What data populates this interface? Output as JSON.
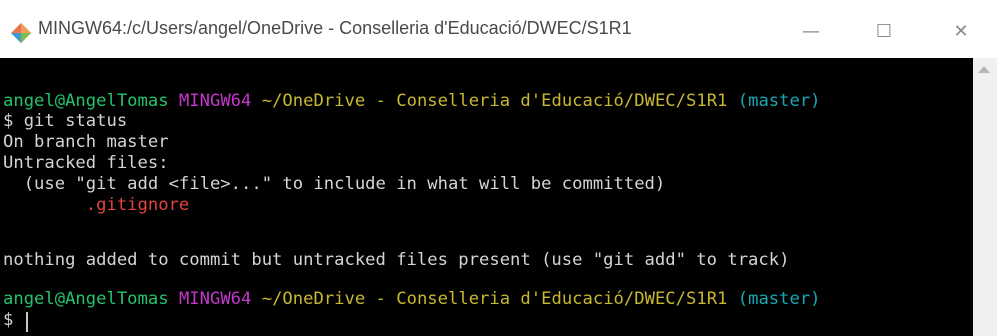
{
  "window": {
    "title": "MINGW64:/c/Users/angel/OneDrive - Conselleria d'Educació/DWEC/S1R1",
    "minimize_glyph": "—",
    "maximize_glyph": "☐",
    "close_glyph": "✕"
  },
  "icons": {
    "app": "git-bash-icon",
    "minimize": "minimize-icon",
    "maximize": "maximize-icon",
    "close": "close-icon"
  },
  "colors": {
    "prompt_user": "#23c36b",
    "prompt_env": "#c337ca",
    "prompt_path": "#c8b730",
    "prompt_branch": "#18a8b4",
    "untracked_file": "#e0443f"
  },
  "terminal": {
    "prompt1": {
      "user": "angel@AngelTomas",
      "env": "MINGW64",
      "path": "~/OneDrive - Conselleria d'Educació/DWEC/S1R1",
      "branch": "(master)"
    },
    "command1": "$ git status",
    "output": [
      "On branch master",
      "Untracked files:",
      "  (use \"git add <file>...\" to include in what will be committed)",
      "        .gitignore",
      "",
      "nothing added to commit but untracked files present (use \"git add\" to track)"
    ],
    "prompt2": {
      "user": "angel@AngelTomas",
      "env": "MINGW64",
      "path": "~/OneDrive - Conselleria d'Educació/DWEC/S1R1",
      "branch": "(master)"
    },
    "input_prompt": "$"
  }
}
